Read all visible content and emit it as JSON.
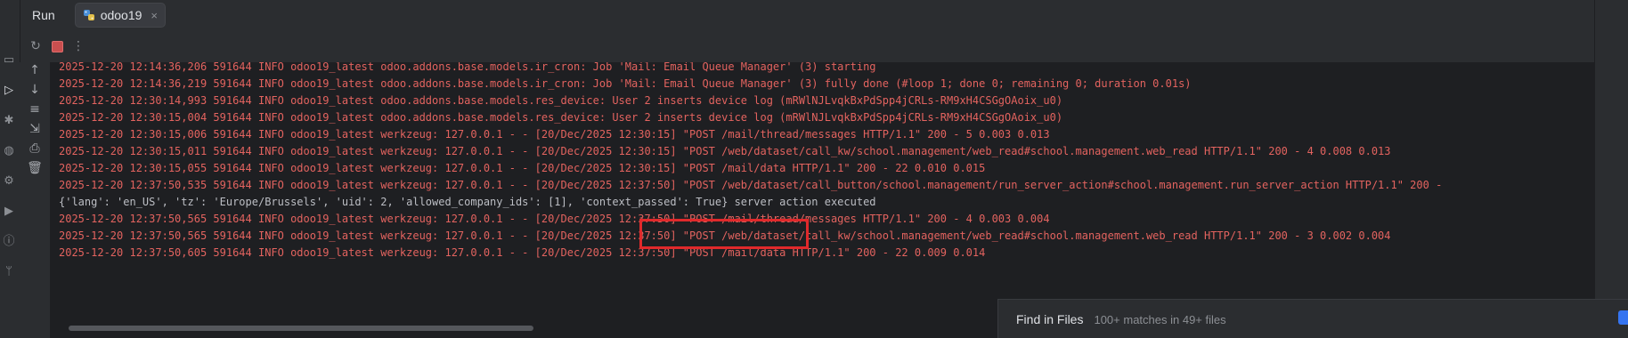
{
  "header": {
    "run_title": "Run",
    "tab_label": "odoo19",
    "tab_close": "×"
  },
  "toolbar": {
    "rerun_icon": "↻",
    "more_icon": "⋮"
  },
  "side_actions": {
    "up": "↑",
    "down": "↓",
    "wrap": "≡",
    "scroll_end": "⇲",
    "print": "⎙",
    "clear": "🗑"
  },
  "log": {
    "lines": [
      "2025-12-20 12:14:36,206 591644 INFO odoo19_latest odoo.addons.base.models.ir_cron: Job 'Mail: Email Queue Manager' (3) starting",
      "2025-12-20 12:14:36,219 591644 INFO odoo19_latest odoo.addons.base.models.ir_cron: Job 'Mail: Email Queue Manager' (3) fully done (#loop 1; done 0; remaining 0; duration 0.01s)",
      "2025-12-20 12:30:14,993 591644 INFO odoo19_latest odoo.addons.base.models.res_device: User 2 inserts device log (mRWlNJLvqkBxPdSpp4jCRLs-RM9xH4CSGgOAoix_u0)",
      "2025-12-20 12:30:15,004 591644 INFO odoo19_latest odoo.addons.base.models.res_device: User 2 inserts device log (mRWlNJLvqkBxPdSpp4jCRLs-RM9xH4CSGgOAoix_u0)",
      "2025-12-20 12:30:15,006 591644 INFO odoo19_latest werkzeug: 127.0.0.1 - - [20/Dec/2025 12:30:15] \"POST /mail/thread/messages HTTP/1.1\" 200 - 5 0.003 0.013",
      "2025-12-20 12:30:15,011 591644 INFO odoo19_latest werkzeug: 127.0.0.1 - - [20/Dec/2025 12:30:15] \"POST /web/dataset/call_kw/school.management/web_read#school.management.web_read HTTP/1.1\" 200 - 4 0.008 0.013",
      "2025-12-20 12:30:15,055 591644 INFO odoo19_latest werkzeug: 127.0.0.1 - - [20/Dec/2025 12:30:15] \"POST /mail/data HTTP/1.1\" 200 - 22 0.010 0.015",
      "2025-12-20 12:37:50,535 591644 INFO odoo19_latest werkzeug: 127.0.0.1 - - [20/Dec/2025 12:37:50] \"POST /web/dataset/call_button/school.management/run_server_action#school.management.run_server_action HTTP/1.1\" 200 -",
      "{'lang': 'en_US', 'tz': 'Europe/Brussels', 'uid': 2, 'allowed_company_ids': [1], 'context_passed': True} server action executed",
      "2025-12-20 12:37:50,565 591644 INFO odoo19_latest werkzeug: 127.0.0.1 - - [20/Dec/2025 12:37:50] \"POST /mail/thread/messages HTTP/1.1\" 200 - 4 0.003 0.004",
      "2025-12-20 12:37:50,565 591644 INFO odoo19_latest werkzeug: 127.0.0.1 - - [20/Dec/2025 12:37:50] \"POST /web/dataset/call_kw/school.management/web_read#school.management.web_read HTTP/1.1\" 200 - 3 0.002 0.004",
      "2025-12-20 12:37:50,605 591644 INFO odoo19_latest werkzeug: 127.0.0.1 - - [20/Dec/2025 12:37:50] \"POST /mail/data HTTP/1.1\" 200 - 22 0.009 0.014"
    ]
  },
  "find_panel": {
    "title": "Find in Files",
    "summary": "100+ matches in 49+ files"
  },
  "colors": {
    "error_text": "#e3635f",
    "plain_text": "#bcbec4",
    "highlight_border": "#e0292b"
  }
}
